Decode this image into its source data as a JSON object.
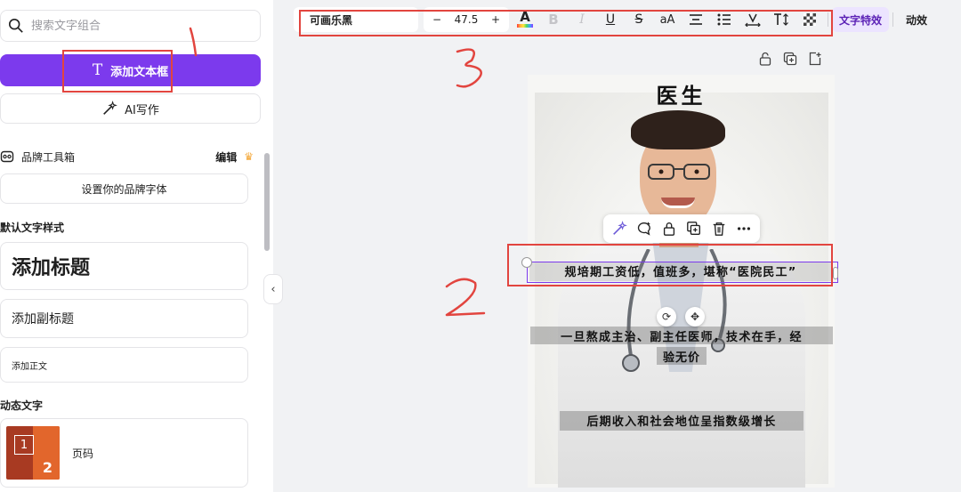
{
  "sidebar": {
    "search_placeholder": "搜索文字组合",
    "add_textbox_label": "添加文本框",
    "add_textbox_glyph": "T",
    "ai_write_label": "AI写作",
    "brand_title": "品牌工具箱",
    "brand_edit": "编辑",
    "crown": "♛",
    "set_brand_font": "设置你的品牌字体",
    "default_styles_title": "默认文字样式",
    "add_heading": "添加标题",
    "add_subheading": "添加副标题",
    "add_body": "添加正文",
    "dynamic_title": "动态文字",
    "page_number_label": "页码",
    "thumb_1": "1",
    "thumb_2": "2",
    "collapse": "‹"
  },
  "toolbar": {
    "font_name": "可画乐黑",
    "size_minus": "−",
    "font_size": "47.5",
    "size_plus": "+",
    "color_letter": "A",
    "bold": "B",
    "italic": "I",
    "underline": "U",
    "strike": "S",
    "case": "aA",
    "text_effects": "文字特效",
    "animate": "动效"
  },
  "canvas": {
    "title": "医生",
    "caption_1": "规培期工资低，值班多，堪称“医院民工”",
    "caption_2_line1": "一旦熬成主治、副主任医师，技术在手，经",
    "caption_2_line2": "验无价",
    "caption_3": "后期收入和社会地位呈指数级增长"
  },
  "annotations": {
    "n1": "1",
    "n2": "2",
    "n3": "3"
  },
  "colors": {
    "accent": "#7c3aed",
    "annotation_red": "#e2453f"
  }
}
